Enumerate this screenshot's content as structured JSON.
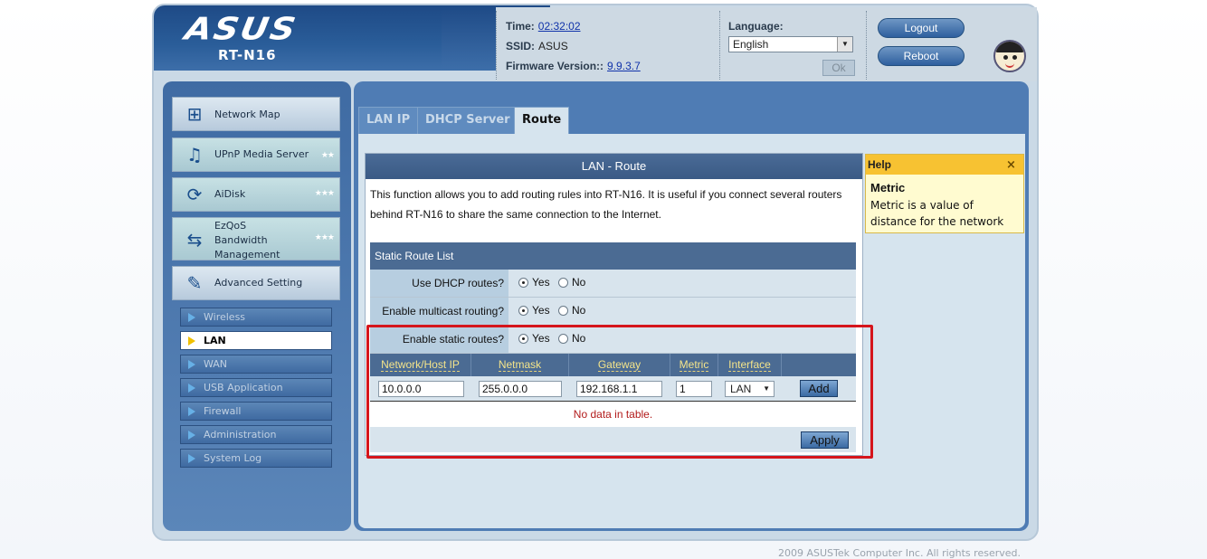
{
  "header": {
    "brand": "ASUS",
    "model": "RT-N16",
    "time_label": "Time:",
    "time_value": "02:32:02",
    "ssid_label": "SSID:",
    "ssid_value": "ASUS",
    "firmware_label": "Firmware Version::",
    "firmware_value": "9.9.3.7",
    "language_label": "Language:",
    "language_value": "English",
    "ok_label": "Ok",
    "logout_label": "Logout",
    "reboot_label": "Reboot"
  },
  "sidebar": {
    "main_items": [
      {
        "label": "Network Map",
        "icon": "network-map-icon"
      },
      {
        "label": "UPnP Media Server",
        "icon": "media-server-icon"
      },
      {
        "label": "AiDisk",
        "icon": "aidisk-icon"
      },
      {
        "label": "EzQoS Bandwidth Management",
        "icon": "qos-icon"
      },
      {
        "label": "Advanced Setting",
        "icon": "advanced-setting-icon"
      }
    ],
    "sub_items": [
      {
        "label": "Wireless"
      },
      {
        "label": "LAN"
      },
      {
        "label": "WAN"
      },
      {
        "label": "USB Application"
      },
      {
        "label": "Firewall"
      },
      {
        "label": "Administration"
      },
      {
        "label": "System Log"
      }
    ]
  },
  "tabs": [
    {
      "label": "LAN IP"
    },
    {
      "label": "DHCP Server"
    },
    {
      "label": "Route"
    }
  ],
  "content": {
    "title": "LAN - Route",
    "description": "This function allows you to add routing rules into RT-N16. It is useful if you connect several routers behind RT-N16 to share the same connection to the Internet.",
    "table_title": "Static Route List",
    "settings": [
      {
        "label": "Use DHCP routes?",
        "yes": "Yes",
        "no": "No",
        "selected": "Yes"
      },
      {
        "label": "Enable multicast routing?",
        "yes": "Yes",
        "no": "No",
        "selected": "Yes"
      },
      {
        "label": "Enable static routes?",
        "yes": "Yes",
        "no": "No",
        "selected": "Yes"
      }
    ],
    "columns": [
      "Network/Host IP",
      "Netmask",
      "Gateway",
      "Metric",
      "Interface"
    ],
    "entry": {
      "network": "10.0.0.0",
      "netmask": "255.0.0.0",
      "gateway": "192.168.1.1",
      "metric": "1",
      "interface": "LAN"
    },
    "add_label": "Add",
    "empty_message": "No data in table.",
    "apply_label": "Apply"
  },
  "help": {
    "title": "Help",
    "term": "Metric",
    "text": "Metric is a value of distance for the network"
  },
  "footer": "2009 ASUSTek Computer Inc. All rights reserved.",
  "colors": {
    "highlight_border": "#d5151c",
    "header_blue": "#2a5d99",
    "help_header": "#f7c232"
  }
}
